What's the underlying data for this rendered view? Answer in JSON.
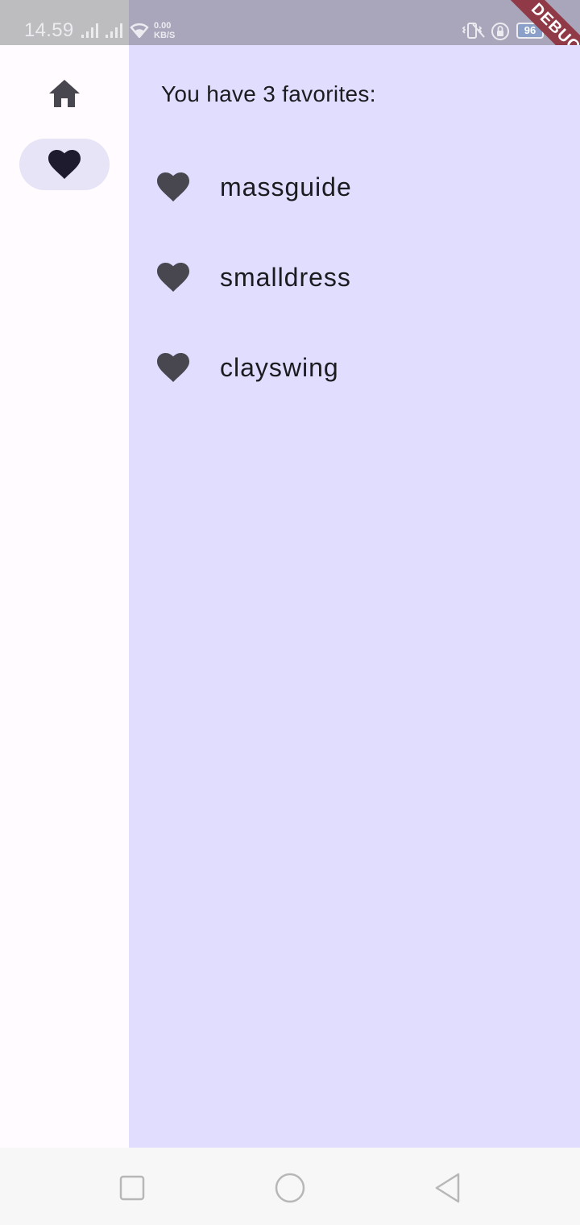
{
  "status_bar": {
    "time": "14.59",
    "net_speed_value": "0.00",
    "net_speed_unit": "KB/S",
    "battery_level": "96",
    "debug_banner": "DEBUG",
    "icons": [
      "signal-icon",
      "signal-icon",
      "wifi-icon",
      "vibrate-icon",
      "alarm-off-icon",
      "rotation-lock-icon",
      "battery-icon",
      "charging-icon"
    ]
  },
  "nav_rail": {
    "destinations": [
      {
        "icon": "home-icon",
        "selected": false
      },
      {
        "icon": "heart-icon",
        "selected": true
      }
    ]
  },
  "favorites": {
    "heading": "You have 3 favorites:",
    "items": [
      {
        "icon": "heart-icon",
        "label": "massguide"
      },
      {
        "icon": "heart-icon",
        "label": "smalldress"
      },
      {
        "icon": "heart-icon",
        "label": "clayswing"
      }
    ]
  },
  "system_nav": {
    "buttons": [
      "recents-button",
      "home-button",
      "back-button"
    ]
  },
  "colors": {
    "content_background": "#e0ddff",
    "rail_background": "#fffbfe",
    "rail_indicator": "#e6e4f6",
    "icon": "#48464f",
    "text": "#1c1b1f",
    "status_bar": "#a9a6bb",
    "debug_ribbon": "#8f3a46"
  }
}
